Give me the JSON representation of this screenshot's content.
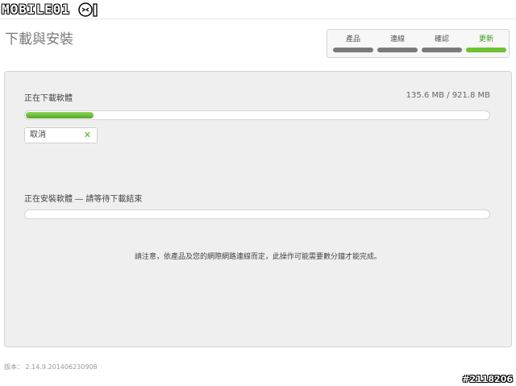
{
  "logo": {
    "text": "MOBILE01"
  },
  "header": {
    "title": "下載與安裝"
  },
  "steps": [
    {
      "label": "產品",
      "active": false
    },
    {
      "label": "連線",
      "active": false
    },
    {
      "label": "確認",
      "active": false
    },
    {
      "label": "更新",
      "active": true
    }
  ],
  "download": {
    "label": "正在下載軟體",
    "size_text": "135.6 MB / 921.8 MB",
    "progress_fraction": 0.147,
    "cancel_label": "取消",
    "cancel_icon": "close-icon"
  },
  "install": {
    "label": "正在安裝軟體 ― 請等待下載結束",
    "progress_fraction": 0.0
  },
  "note": "請注意，依產品及您的網際網路連線而定，此操作可能需要數分鐘才能完成。",
  "footer": {
    "version": "版本： 2.14.9.201406230908"
  },
  "watermark": "#2118206",
  "colors": {
    "accent": "#6ec234",
    "inactive_step": "#7a7a7a"
  }
}
